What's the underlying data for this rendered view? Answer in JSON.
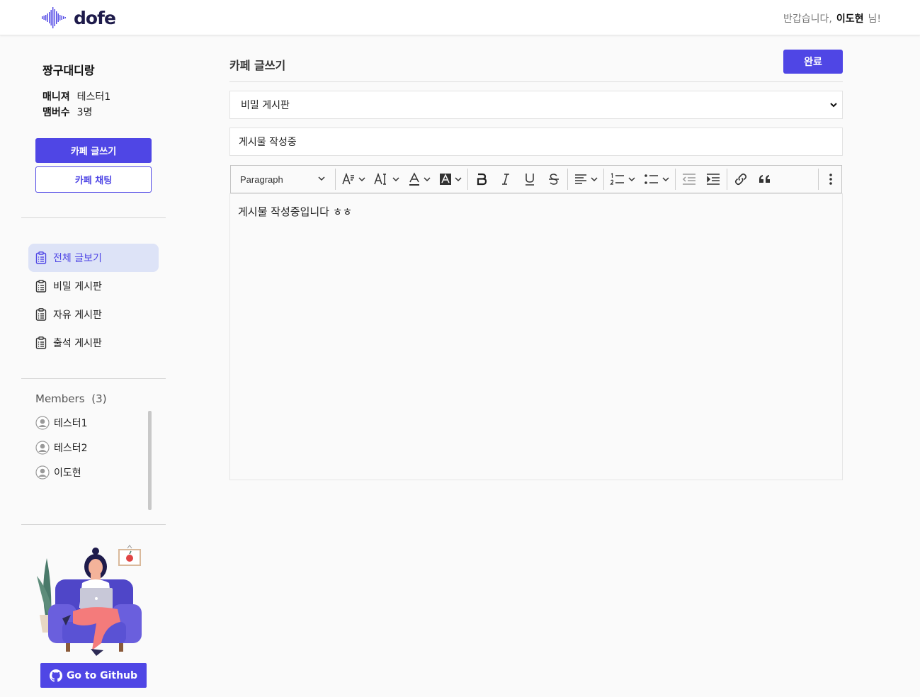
{
  "header": {
    "logo_text": "dofe",
    "greeting": "반갑습니다,",
    "user_name": "이도현",
    "suffix": "님!"
  },
  "sidebar": {
    "cafe_name": "짱구대디랑",
    "manager_label": "매니져",
    "manager_value": "테스터1",
    "members_label": "맴버수",
    "members_value": "3명",
    "write_button": "카페 글쓰기",
    "chat_button": "카페 채팅",
    "nav": [
      {
        "label": "전체 글보기",
        "active": true
      },
      {
        "label": "비밀 게시판",
        "active": false
      },
      {
        "label": "자유 게시판",
        "active": false
      },
      {
        "label": "출석 게시판",
        "active": false
      }
    ],
    "members_title": "Members",
    "members_count": "(3)",
    "members": [
      "테스터1",
      "테스터2",
      "이도현"
    ],
    "github_button": "Go to Github"
  },
  "main": {
    "title": "카페 글쓰기",
    "done_button": "완료",
    "board_select": "비밀 게시판",
    "post_title": "게시물 작성중",
    "toolbar": {
      "paragraph": "Paragraph"
    },
    "editor_content": "게시물 작성중입니다 ㅎㅎ"
  },
  "colors": {
    "accent": "#4f46e5",
    "active_nav_bg": "#dde3f7"
  }
}
